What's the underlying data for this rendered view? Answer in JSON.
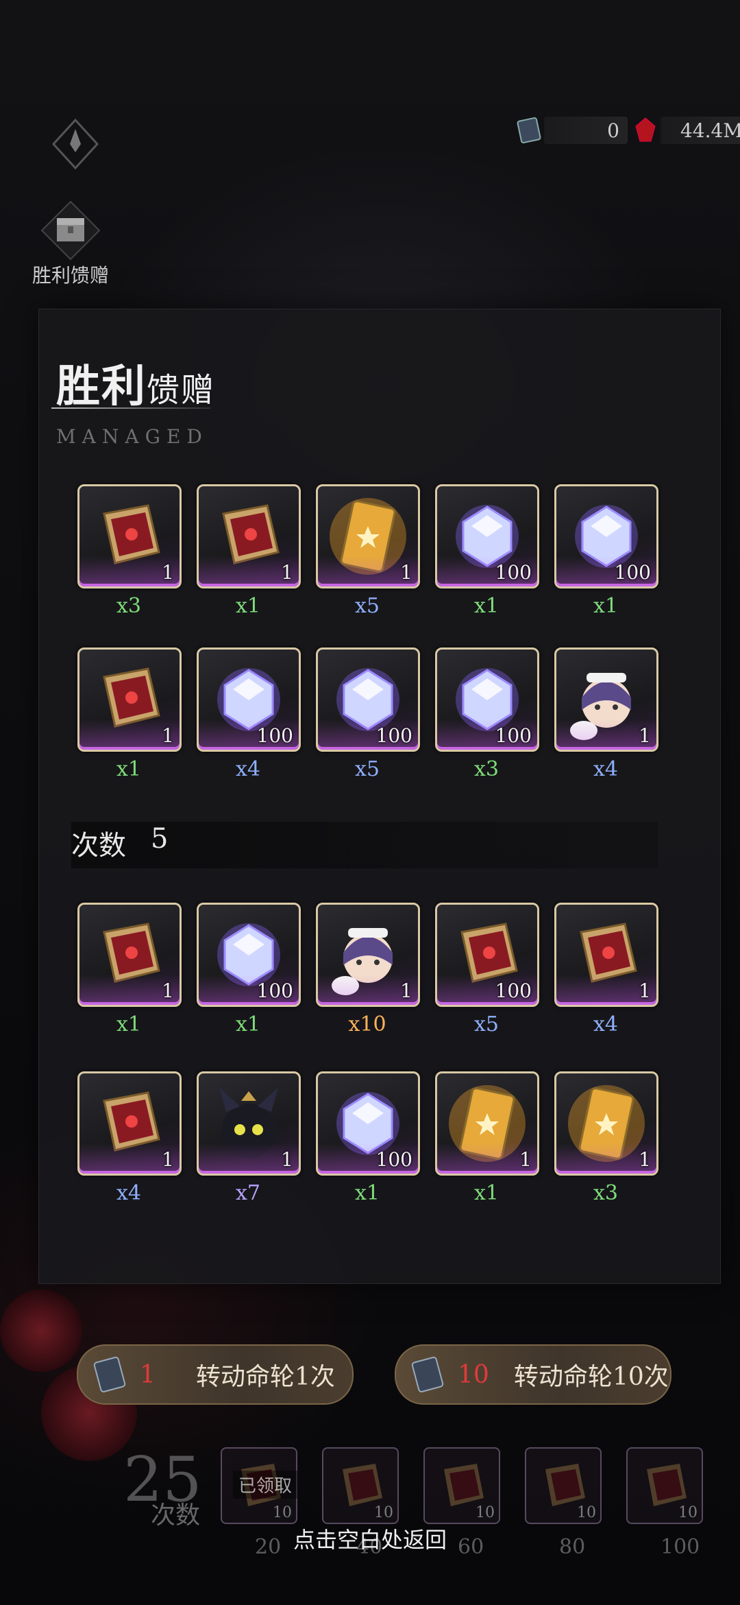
{
  "header": {
    "chest_label": "胜利馈赠",
    "currency_tickets": "0",
    "currency_gems": "44.4M"
  },
  "panel": {
    "title_main": "胜利",
    "title_sub": "馈赠",
    "title_en": "MANAGED",
    "count_label": "次数",
    "count_value": "5",
    "rows": [
      [
        {
          "icon": "box",
          "qty": "1",
          "mult": "x3",
          "color": "g"
        },
        {
          "icon": "box",
          "qty": "1",
          "mult": "x1",
          "color": "g"
        },
        {
          "icon": "card",
          "qty": "1",
          "mult": "x5",
          "color": "b"
        },
        {
          "icon": "gem",
          "qty": "100",
          "mult": "x1",
          "color": "g"
        },
        {
          "icon": "gem",
          "qty": "100",
          "mult": "x1",
          "color": "g"
        }
      ],
      [
        {
          "icon": "box",
          "qty": "1",
          "mult": "x1",
          "color": "g"
        },
        {
          "icon": "gem",
          "qty": "100",
          "mult": "x4",
          "color": "b"
        },
        {
          "icon": "gem",
          "qty": "100",
          "mult": "x5",
          "color": "b"
        },
        {
          "icon": "gem",
          "qty": "100",
          "mult": "x3",
          "color": "g"
        },
        {
          "icon": "maid",
          "qty": "1",
          "mult": "x4",
          "color": "b"
        }
      ],
      [
        {
          "icon": "box",
          "qty": "1",
          "mult": "x1",
          "color": "g"
        },
        {
          "icon": "gem",
          "qty": "100",
          "mult": "x1",
          "color": "g"
        },
        {
          "icon": "maid",
          "qty": "1",
          "mult": "x10",
          "color": "o"
        },
        {
          "icon": "box",
          "qty": "100",
          "mult": "x5",
          "color": "b"
        },
        {
          "icon": "box",
          "qty": "1",
          "mult": "x4",
          "color": "b"
        }
      ],
      [
        {
          "icon": "box",
          "qty": "1",
          "mult": "x4",
          "color": "b"
        },
        {
          "icon": "cat",
          "qty": "1",
          "mult": "x7",
          "color": "p"
        },
        {
          "icon": "gem",
          "qty": "100",
          "mult": "x1",
          "color": "g"
        },
        {
          "icon": "card",
          "qty": "1",
          "mult": "x1",
          "color": "g"
        },
        {
          "icon": "card",
          "qty": "1",
          "mult": "x3",
          "color": "g"
        }
      ]
    ]
  },
  "buttons": {
    "spin1_cost": "1",
    "spin1_label": "转动命轮1次",
    "spin10_cost": "10",
    "spin10_label": "转动命轮10次"
  },
  "progress": {
    "count": "25",
    "count_label": "次数",
    "claimed": "已领取",
    "milestones": [
      "20",
      "40",
      "60",
      "80",
      "100"
    ],
    "reward_qty": "10"
  },
  "hint": "点击空白处返回",
  "colors": {
    "accent_border": "#d9c9a5",
    "rarity_purple": "#c66be0",
    "green_text": "#7fdc7a",
    "blue_text": "#8fb0ff",
    "orange_text": "#ffb35a"
  }
}
